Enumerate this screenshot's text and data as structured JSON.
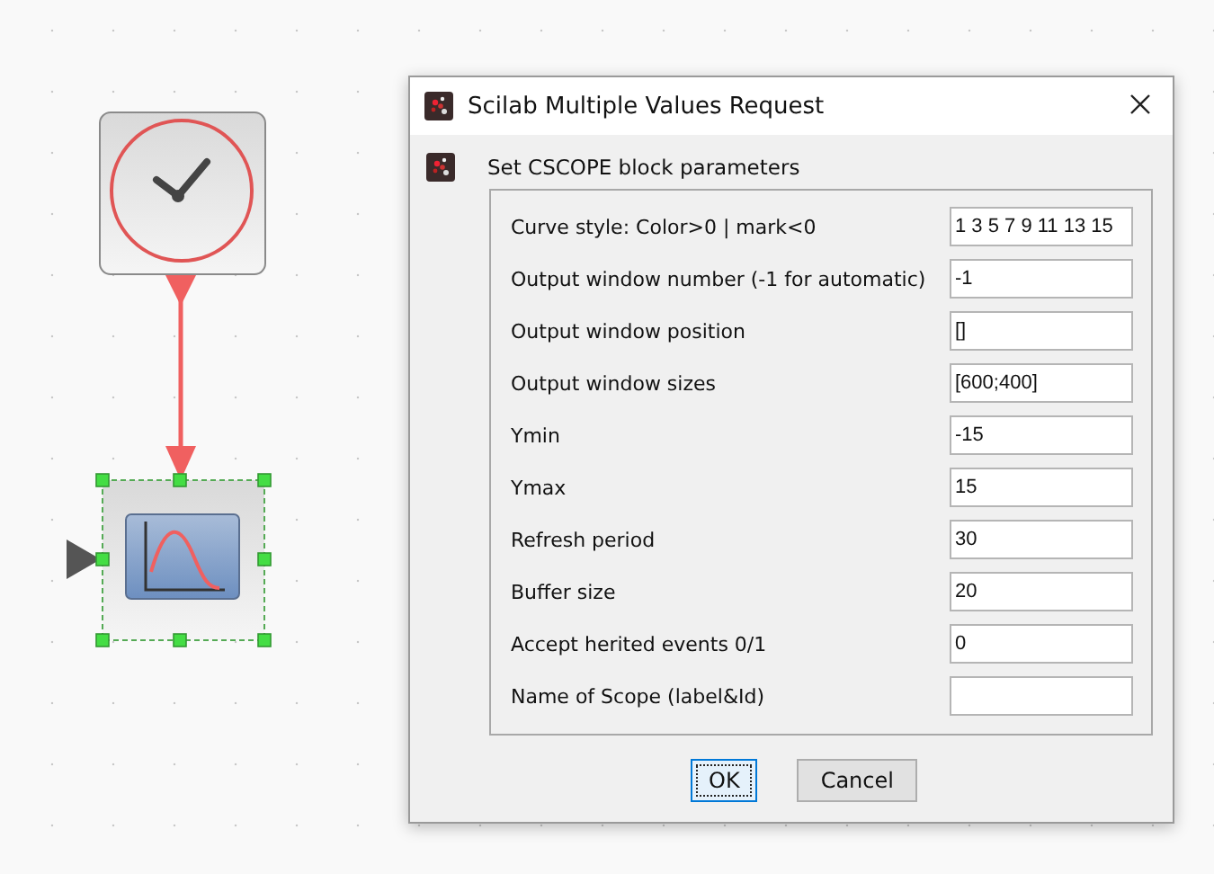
{
  "dialog": {
    "title": "Scilab Multiple Values Request",
    "heading": "Set CSCOPE block parameters",
    "fields": [
      {
        "label": "Curve style: Color>0 | mark<0",
        "value": "1 3 5 7 9 11 13 15"
      },
      {
        "label": "Output window number (-1 for automatic)",
        "value": "-1"
      },
      {
        "label": "Output window position",
        "value": "[]"
      },
      {
        "label": "Output window sizes",
        "value": "[600;400]"
      },
      {
        "label": "Ymin",
        "value": "-15"
      },
      {
        "label": "Ymax",
        "value": "15"
      },
      {
        "label": "Refresh period",
        "value": "30"
      },
      {
        "label": "Buffer size",
        "value": "20"
      },
      {
        "label": "Accept herited events 0/1",
        "value": "0"
      },
      {
        "label": "Name of Scope (label&Id)"
      }
    ],
    "buttons": [
      {
        "label": "OK",
        "focused": true
      },
      {
        "label": "Cancel",
        "focused": false
      }
    ]
  },
  "diagram": {
    "scope_block": {
      "selected": true
    }
  }
}
